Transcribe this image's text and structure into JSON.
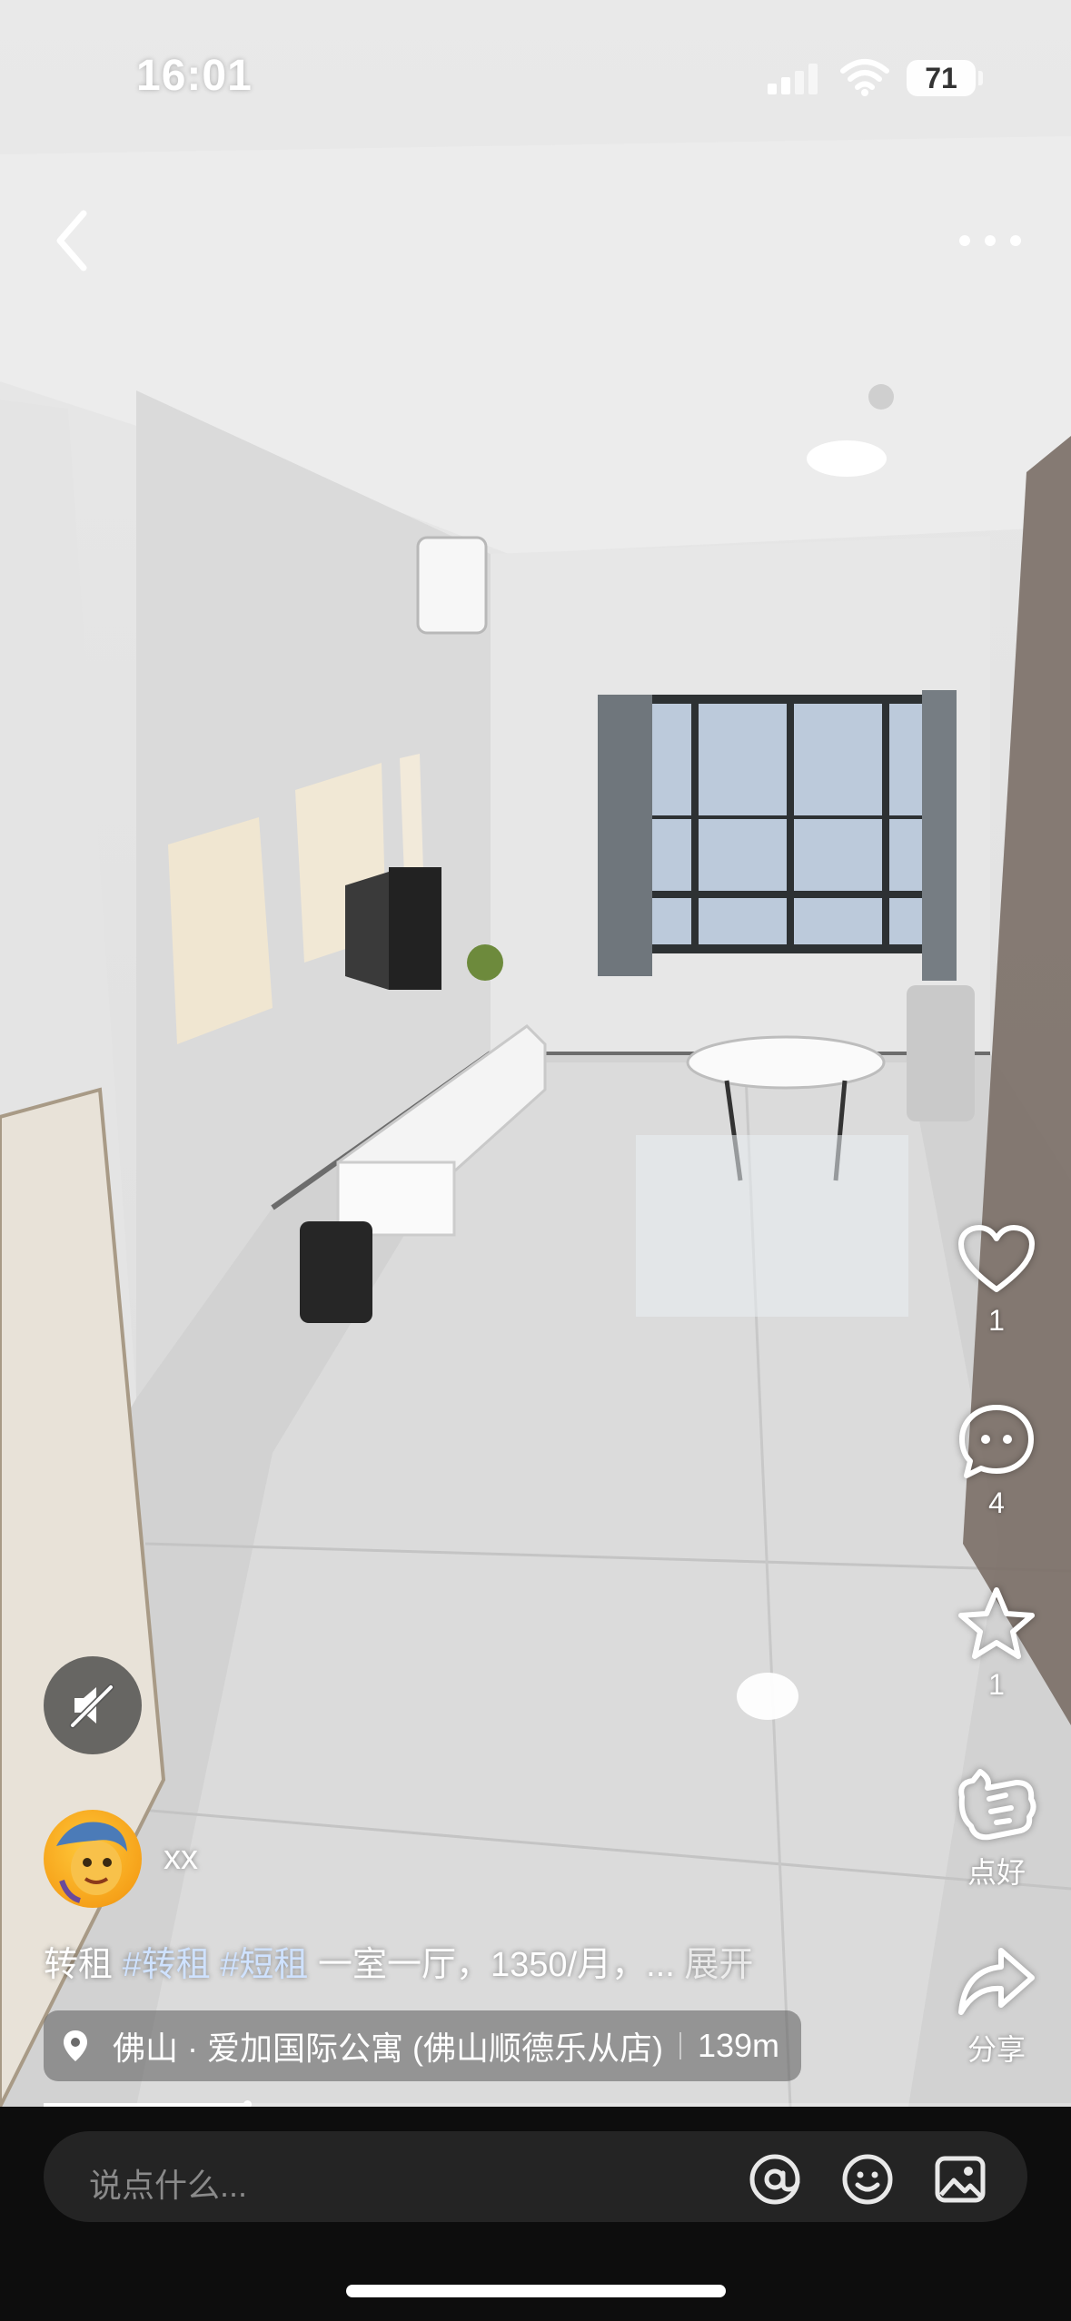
{
  "status_bar": {
    "time": "16:01",
    "battery": "71"
  },
  "actions": {
    "like": {
      "icon": "heart-icon",
      "count": "1"
    },
    "comment": {
      "icon": "comment-icon",
      "count": "4"
    },
    "favorite": {
      "icon": "star-icon",
      "count": "1"
    },
    "good": {
      "icon": "thumbs-up-icon",
      "label": "点好"
    },
    "share": {
      "icon": "share-arrow-icon",
      "label": "分享"
    }
  },
  "post": {
    "author": "xx",
    "caption_text": "转租",
    "tags": [
      "#转租",
      "#短租"
    ],
    "caption_more": "一室一厅，1350/月，...",
    "expand_label": "展开",
    "location": "佛山 · 爱加国际公寓 (佛山顺德乐从店)",
    "distance": "139m"
  },
  "comment_bar": {
    "placeholder": "说点什么..."
  },
  "colors": {
    "background": "#0d0d0d",
    "input": "#242424",
    "tag": "#cfe2ff"
  }
}
